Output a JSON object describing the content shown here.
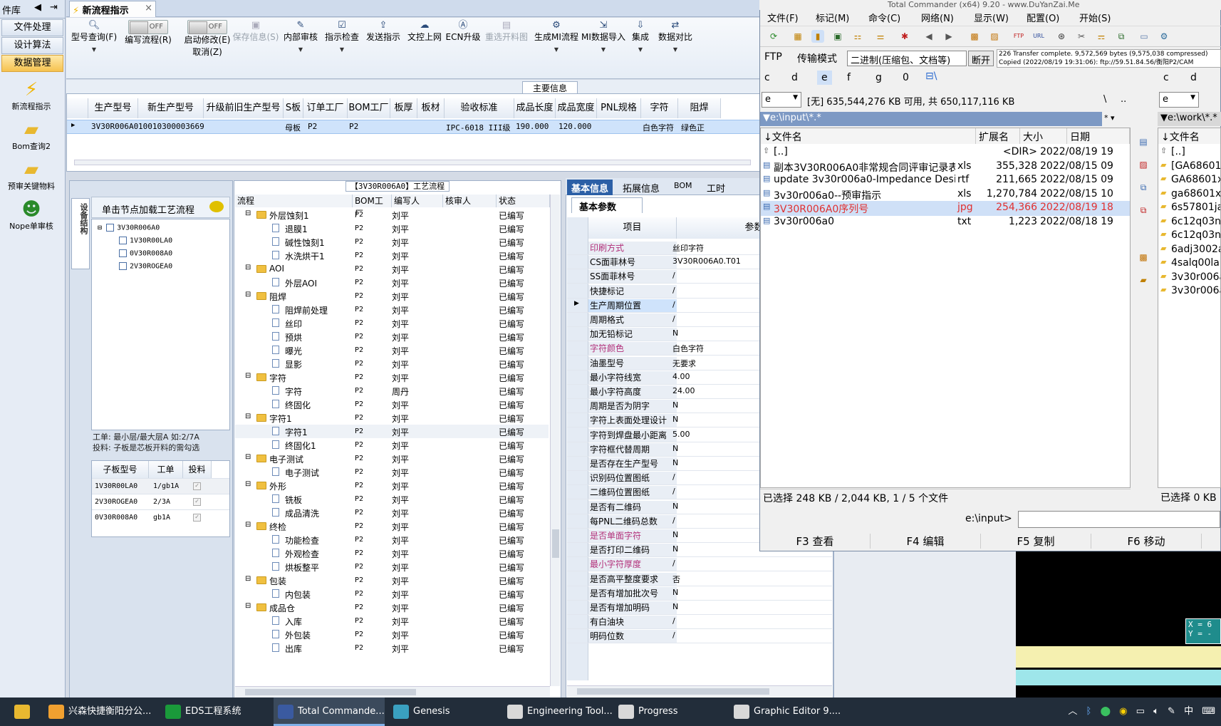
{
  "leftnav": {
    "header": "件库",
    "items": [
      "文件处理",
      "设计算法",
      "数据管理"
    ],
    "big_icons": [
      "新流程指示",
      "Bom查询2",
      "预审关键物料",
      "Nope单审核"
    ]
  },
  "main": {
    "tab": "新流程指示",
    "toolbar": [
      {
        "label": "型号查询(F)",
        "icon": "search-icon"
      },
      {
        "label": "编写流程(R)",
        "toggle": "OFF"
      },
      {
        "label": "启动修改(E)",
        "toggle": "OFF",
        "sub": "取消(Z)"
      },
      {
        "label": "保存信息(S)",
        "disabled": true
      },
      {
        "label": "内部审核"
      },
      {
        "label": "指示检查"
      },
      {
        "label": "发送指示"
      },
      {
        "label": "文控上网"
      },
      {
        "label": "ECN升级"
      },
      {
        "label": "重选开料图",
        "disabled": true
      },
      {
        "label": "生成MI流程"
      },
      {
        "label": "MI数据导入"
      },
      {
        "label": "集成"
      },
      {
        "label": "数据对比"
      }
    ],
    "main_info_label": "主要信息",
    "grid_headers": [
      "生产型号",
      "新生产型号",
      "升级前旧生产型号",
      "S板",
      "订单工厂",
      "BOM工厂",
      "板厚",
      "板材",
      "验收标准",
      "成品长度",
      "成品宽度",
      "PNL规格",
      "字符",
      "阻焊"
    ],
    "grid_row": [
      "3V30R006A0",
      "10010300003669",
      "",
      "母板",
      "P2",
      "P2",
      "",
      "",
      "IPC-6018 III级",
      "190.000",
      "120.000",
      "",
      "白色字符",
      "绿色正"
    ]
  },
  "tree": {
    "vertical_tab": "设备结构",
    "header": "单击节点加载工艺流程",
    "root": "3V30R006A0",
    "children": [
      "1V30R00LA0",
      "0V30R008A0",
      "2V30ROGEA0"
    ],
    "note_line1": "工单: 最小层/最大层A 如:2/7A",
    "note_line2": "投料: 子板是芯板开料的需勾选",
    "sub_headers": [
      "子板型号",
      "工单",
      "投料"
    ],
    "sub_rows": [
      [
        "1V30R00LA0",
        "1/gb1A"
      ],
      [
        "2V30ROGEA0",
        "2/3A"
      ],
      [
        "0V30R008A0",
        "gb1A"
      ]
    ]
  },
  "process": {
    "title": "【3V30R006A0】工艺流程",
    "headers": [
      "流程",
      "BOM工厂",
      "编写人",
      "核审人",
      "状态"
    ],
    "rows": [
      {
        "name": "外层蚀刻1",
        "lvl": 0,
        "fac": "P2",
        "by": "刘平",
        "st": "已编写"
      },
      {
        "name": "退膜1",
        "lvl": 1,
        "fac": "P2",
        "by": "刘平",
        "st": "已编写"
      },
      {
        "name": "碱性蚀刻1",
        "lvl": 1,
        "fac": "P2",
        "by": "刘平",
        "st": "已编写"
      },
      {
        "name": "水洗烘干1",
        "lvl": 1,
        "fac": "P2",
        "by": "刘平",
        "st": "已编写"
      },
      {
        "name": "AOI",
        "lvl": 0,
        "fac": "P2",
        "by": "刘平",
        "st": "已编写"
      },
      {
        "name": "外层AOI",
        "lvl": 1,
        "fac": "P2",
        "by": "刘平",
        "st": "已编写"
      },
      {
        "name": "阻焊",
        "lvl": 0,
        "fac": "P2",
        "by": "刘平",
        "st": "已编写"
      },
      {
        "name": "阻焊前处理",
        "lvl": 1,
        "fac": "P2",
        "by": "刘平",
        "st": "已编写"
      },
      {
        "name": "丝印",
        "lvl": 1,
        "fac": "P2",
        "by": "刘平",
        "st": "已编写"
      },
      {
        "name": "预烘",
        "lvl": 1,
        "fac": "P2",
        "by": "刘平",
        "st": "已编写"
      },
      {
        "name": "曝光",
        "lvl": 1,
        "fac": "P2",
        "by": "刘平",
        "st": "已编写"
      },
      {
        "name": "显影",
        "lvl": 1,
        "fac": "P2",
        "by": "刘平",
        "st": "已编写"
      },
      {
        "name": "字符",
        "lvl": 0,
        "fac": "P2",
        "by": "刘平",
        "st": "已编写"
      },
      {
        "name": "字符",
        "lvl": 1,
        "fac": "P2",
        "by": "周丹",
        "st": "已编写"
      },
      {
        "name": "终固化",
        "lvl": 1,
        "fac": "P2",
        "by": "刘平",
        "st": "已编写"
      },
      {
        "name": "字符1",
        "lvl": 0,
        "fac": "P2",
        "by": "刘平",
        "st": "已编写"
      },
      {
        "name": "字符1",
        "lvl": 1,
        "fac": "P2",
        "by": "刘平",
        "st": "已编写",
        "hl": true
      },
      {
        "name": "终固化1",
        "lvl": 1,
        "fac": "P2",
        "by": "刘平",
        "st": "已编写"
      },
      {
        "name": "电子测试",
        "lvl": 0,
        "fac": "P2",
        "by": "刘平",
        "st": "已编写"
      },
      {
        "name": "电子测试",
        "lvl": 1,
        "fac": "P2",
        "by": "刘平",
        "st": "已编写"
      },
      {
        "name": "外形",
        "lvl": 0,
        "fac": "P2",
        "by": "刘平",
        "st": "已编写"
      },
      {
        "name": "铣板",
        "lvl": 1,
        "fac": "P2",
        "by": "刘平",
        "st": "已编写"
      },
      {
        "name": "成品清洗",
        "lvl": 1,
        "fac": "P2",
        "by": "刘平",
        "st": "已编写"
      },
      {
        "name": "终检",
        "lvl": 0,
        "fac": "P2",
        "by": "刘平",
        "st": "已编写"
      },
      {
        "name": "功能检查",
        "lvl": 1,
        "fac": "P2",
        "by": "刘平",
        "st": "已编写"
      },
      {
        "name": "外观检查",
        "lvl": 1,
        "fac": "P2",
        "by": "刘平",
        "st": "已编写"
      },
      {
        "name": "烘板整平",
        "lvl": 1,
        "fac": "P2",
        "by": "刘平",
        "st": "已编写"
      },
      {
        "name": "包装",
        "lvl": 0,
        "fac": "P2",
        "by": "刘平",
        "st": "已编写"
      },
      {
        "name": "内包装",
        "lvl": 1,
        "fac": "P2",
        "by": "刘平",
        "st": "已编写"
      },
      {
        "name": "成品仓",
        "lvl": 0,
        "fac": "P2",
        "by": "刘平",
        "st": "已编写"
      },
      {
        "name": "入库",
        "lvl": 1,
        "fac": "P2",
        "by": "刘平",
        "st": "已编写"
      },
      {
        "name": "外包装",
        "lvl": 1,
        "fac": "P2",
        "by": "刘平",
        "st": "已编写"
      },
      {
        "name": "出库",
        "lvl": 1,
        "fac": "P2",
        "by": "刘平",
        "st": "已编写"
      }
    ]
  },
  "props": {
    "tabs": [
      "基本信息",
      "拓展信息",
      "BOM",
      "工时"
    ],
    "subtab": "基本参数",
    "headers": [
      "项目",
      "参数"
    ],
    "rows": [
      {
        "k": "印刷方式",
        "v": "丝印字符",
        "pink": true
      },
      {
        "k": "CS面菲林号",
        "v": "3V30R006A0.T01"
      },
      {
        "k": "SS面菲林号",
        "v": "/"
      },
      {
        "k": "快捷标记",
        "v": "/"
      },
      {
        "k": "生产周期位置",
        "v": "/",
        "sel": true
      },
      {
        "k": "周期格式",
        "v": "/"
      },
      {
        "k": "加无铅标记",
        "v": "N"
      },
      {
        "k": "字符颜色",
        "v": "白色字符",
        "pink": true
      },
      {
        "k": "油墨型号",
        "v": "无要求"
      },
      {
        "k": "最小字符线宽",
        "v": "4.00"
      },
      {
        "k": "最小字符高度",
        "v": "24.00"
      },
      {
        "k": "周期是否为阴字",
        "v": "N"
      },
      {
        "k": "字符上表面处理设计",
        "v": "N"
      },
      {
        "k": "字符到焊盘最小距离",
        "v": "5.00"
      },
      {
        "k": "字符框代替周期",
        "v": "N"
      },
      {
        "k": "是否存在生产型号",
        "v": "N"
      },
      {
        "k": "识别码位置图纸",
        "v": "/"
      },
      {
        "k": "二维码位置图纸",
        "v": "/"
      },
      {
        "k": "是否有二维码",
        "v": "N"
      },
      {
        "k": "每PNL二维码总数",
        "v": "/"
      },
      {
        "k": "是否单面字符",
        "v": "N",
        "pink": true
      },
      {
        "k": "是否打印二维码",
        "v": "N"
      },
      {
        "k": "最小字符厚度",
        "v": "/",
        "pink": true
      },
      {
        "k": "是否高平整度要求",
        "v": "否"
      },
      {
        "k": "是否有增加批次号",
        "v": "N"
      },
      {
        "k": "是否有增加明码",
        "v": "N"
      },
      {
        "k": "有白油块",
        "v": "/"
      },
      {
        "k": "明码位数",
        "v": "/"
      }
    ]
  },
  "tc": {
    "title": "Total Commander (x64) 9.20 - www.DuYanZai.Me",
    "menu": [
      "文件(F)",
      "标记(M)",
      "命令(C)",
      "网络(N)",
      "显示(W)",
      "配置(O)",
      "开始(S)"
    ],
    "ftp_label": "FTP",
    "transfer_label": "传输模式",
    "transfer_mode": "二进制(压缩包、文档等)",
    "disconnect": "断开",
    "ftp_log1": "226 Transfer complete. 9,572,569 bytes (9,575,038 compressed)",
    "ftp_log2": "Copied (2022/08/19 19:31:06): ftp://59.51.84.56/衡阳P2/CAM",
    "drives": [
      "c",
      "d",
      "e",
      "f",
      "g",
      "0"
    ],
    "drive_sel": "e",
    "free_space": "[无] 635,544,276 KB 可用, 共 650,117,116 KB",
    "path_left": "e:\\input\\*.*",
    "path_right": "e:\\work\\*.*",
    "cols": [
      "文件名",
      "扩展名",
      "大小",
      "日期"
    ],
    "files": [
      {
        "n": "[..]",
        "e": "",
        "s": "<DIR>",
        "d": "2022/08/19 19"
      },
      {
        "n": "副本3V30R006A0非常规合同评审记录表",
        "e": "xls",
        "s": "355,328",
        "d": "2022/08/15 09"
      },
      {
        "n": "update 3v30r006a0-Impedance Design(..",
        "e": "rtf",
        "s": "211,665",
        "d": "2022/08/15 09"
      },
      {
        "n": "3v30r006a0--预审指示",
        "e": "xls",
        "s": "1,270,784",
        "d": "2022/08/15 10"
      },
      {
        "n": "3V30R006A0序列号",
        "e": "jpg",
        "s": "254,366",
        "d": "2022/08/19 18",
        "sel": true
      },
      {
        "n": "3v30r006a0",
        "e": "txt",
        "s": "1,223",
        "d": "2022/08/18 19"
      }
    ],
    "right_files": [
      "[..]",
      "[GA68601",
      "GA68601x",
      "ga68601x",
      "6s57801ja",
      "6c12q03n",
      "6c12q03n",
      "6adj3002a",
      "4salq00la",
      "3v30r006a",
      "3v30r006a"
    ],
    "status_left": "已选择 248 KB / 2,044 KB, 1 / 5 个文件",
    "status_right": "已选择 0 KB",
    "cmd_prompt": "e:\\input>",
    "fkeys": [
      "F3 查看",
      "F4 编辑",
      "F5 复制",
      "F6 移动"
    ]
  },
  "graphic": {
    "coord_x": "X = 6",
    "coord_y": "Y = -"
  },
  "taskbar": {
    "items": [
      "兴森快捷衡阳分公...",
      "EDS工程系统",
      "Total Commande...",
      "Genesis",
      "Engineering Tool...",
      "Progress",
      "Graphic Editor 9...."
    ],
    "active": 2,
    "ime": "中"
  },
  "colors": {
    "accent": "#2b5fa6",
    "selected_row": "#cfe3fb",
    "pink_label": "#b2307a",
    "tc_selected_text": "#e03030"
  }
}
